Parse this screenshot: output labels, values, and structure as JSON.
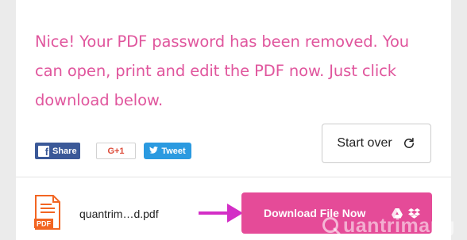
{
  "message": "Nice! Your PDF password has been removed. You can open, print and edit the PDF now. Just click download below.",
  "social": {
    "share_label": "Share",
    "gplus_label": "G+1",
    "tweet_label": "Tweet"
  },
  "start_over_label": "Start over",
  "file": {
    "name": "quantrim…d.pdf",
    "icon_label": "PDF"
  },
  "download_label": "Download File Now",
  "icons": {
    "facebook": "facebook-icon",
    "twitter": "twitter-bird-icon",
    "refresh": "refresh-icon",
    "pdf": "pdf-file-icon",
    "arrow": "arrow-right-icon",
    "drive": "google-drive-icon",
    "dropbox": "dropbox-icon"
  },
  "watermark": "uantrimang",
  "colors": {
    "accent_pink": "#e0569d",
    "download_button": "#e54b98",
    "arrow": "#d32ec6",
    "facebook": "#3b5998",
    "twitter": "#2b9ae0",
    "gplus": "#dd4b39",
    "pdf_orange": "#f26522"
  }
}
